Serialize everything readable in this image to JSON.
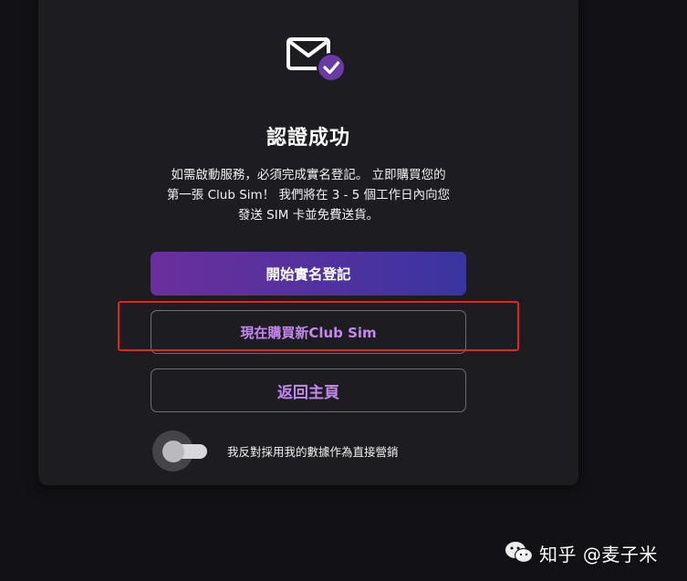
{
  "card": {
    "title": "認證成功",
    "description": "如需啟動服務，必須完成實名登記。 立即購買您的\n第一張 Club Sim！ 我們將在 3 - 5 個工作日內向您\n發送 SIM 卡並免費送貨。"
  },
  "buttons": {
    "register_label": "開始實名登記",
    "buy_label": "現在購買新Club Sim",
    "home_label": "返回主頁"
  },
  "marketing_toggle": {
    "label": "我反對採用我的數據作為直接營銷",
    "state": "off"
  },
  "watermark": {
    "text": "知乎 @麦子米"
  },
  "colors": {
    "background": "#121216",
    "card": "#1c1c21",
    "accent_purple": "#6b2f9c",
    "accent_text": "#c388ee",
    "highlight_red": "#e0271f"
  },
  "icons": {
    "header": "mail-check-icon",
    "watermark": "wechat-icon"
  }
}
